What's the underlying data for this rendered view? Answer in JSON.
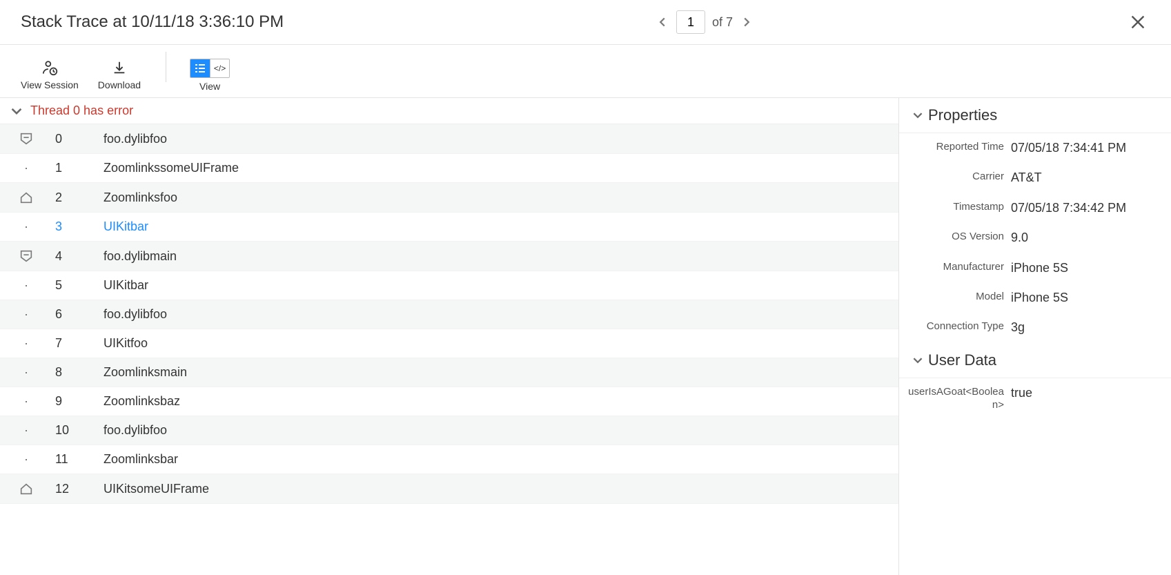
{
  "header": {
    "title": "Stack Trace at 10/11/18 3:36:10 PM",
    "page_current": "1",
    "page_total_label": "of 7"
  },
  "toolbar": {
    "view_session_label": "View Session",
    "download_label": "Download",
    "view_label": "View",
    "code_toggle_label": "</>"
  },
  "thread": {
    "title": "Thread 0 has error",
    "frames": [
      {
        "index": "0",
        "name": "foo.dylibfoo",
        "marker": "shield",
        "alt": true,
        "selected": false
      },
      {
        "index": "1",
        "name": "ZoomlinkssomeUIFrame",
        "marker": "line",
        "alt": false,
        "selected": false
      },
      {
        "index": "2",
        "name": "Zoomlinksfoo",
        "marker": "house",
        "alt": true,
        "selected": false
      },
      {
        "index": "3",
        "name": "UIKitbar",
        "marker": "line",
        "alt": false,
        "selected": true
      },
      {
        "index": "4",
        "name": "foo.dylibmain",
        "marker": "shield",
        "alt": true,
        "selected": false
      },
      {
        "index": "5",
        "name": "UIKitbar",
        "marker": "line",
        "alt": false,
        "selected": false
      },
      {
        "index": "6",
        "name": "foo.dylibfoo",
        "marker": "line",
        "alt": true,
        "selected": false
      },
      {
        "index": "7",
        "name": "UIKitfoo",
        "marker": "line",
        "alt": false,
        "selected": false
      },
      {
        "index": "8",
        "name": "Zoomlinksmain",
        "marker": "line",
        "alt": true,
        "selected": false
      },
      {
        "index": "9",
        "name": "Zoomlinksbaz",
        "marker": "line",
        "alt": false,
        "selected": false
      },
      {
        "index": "10",
        "name": "foo.dylibfoo",
        "marker": "line",
        "alt": true,
        "selected": false
      },
      {
        "index": "11",
        "name": "Zoomlinksbar",
        "marker": "line",
        "alt": false,
        "selected": false
      },
      {
        "index": "12",
        "name": "UIKitsomeUIFrame",
        "marker": "house",
        "alt": true,
        "selected": false
      }
    ]
  },
  "sidebar": {
    "properties_title": "Properties",
    "properties": [
      {
        "label": "Reported Time",
        "value": "07/05/18 7:34:41 PM"
      },
      {
        "label": "Carrier",
        "value": "AT&T"
      },
      {
        "label": "Timestamp",
        "value": "07/05/18 7:34:42 PM"
      },
      {
        "label": "OS Version",
        "value": "9.0"
      },
      {
        "label": "Manufacturer",
        "value": "iPhone 5S"
      },
      {
        "label": "Model",
        "value": "iPhone 5S"
      },
      {
        "label": "Connection Type",
        "value": "3g"
      }
    ],
    "userdata_title": "User Data",
    "userdata": [
      {
        "label": "userIsAGoat<Boolean>",
        "value": "true"
      }
    ]
  }
}
